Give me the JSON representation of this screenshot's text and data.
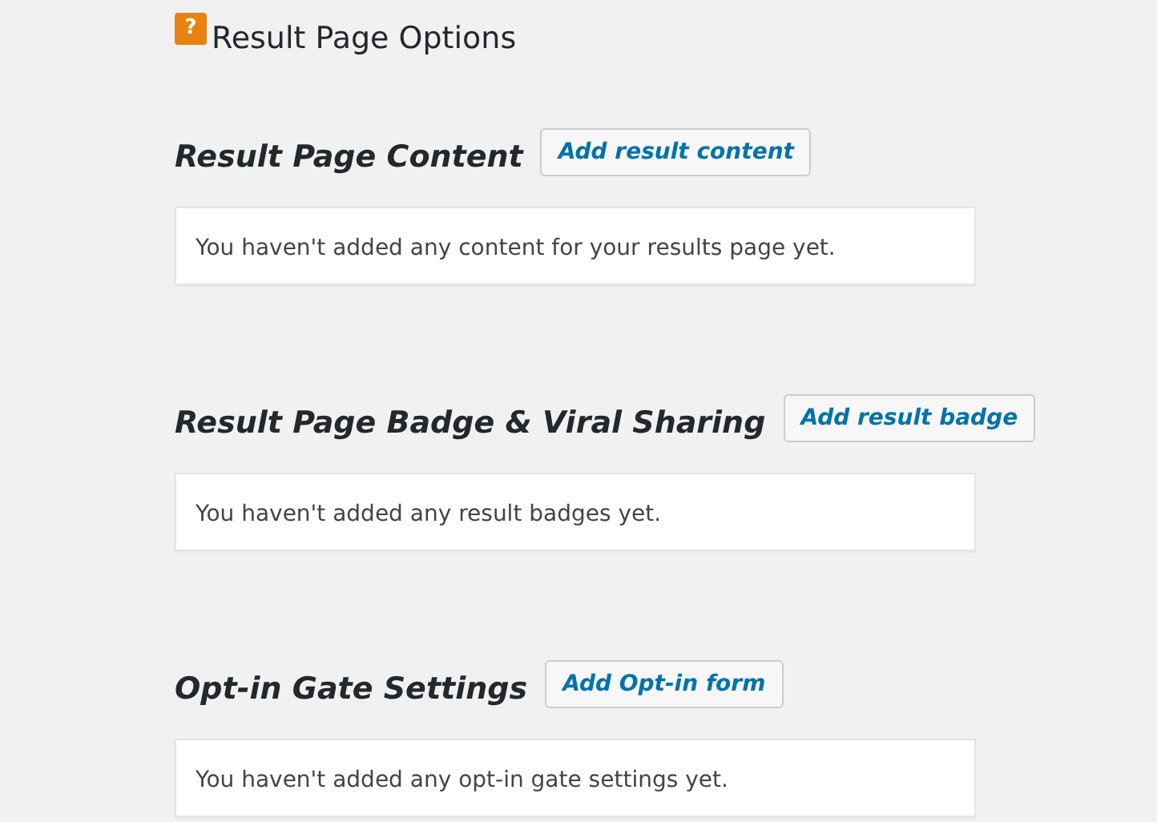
{
  "header": {
    "icon_glyph": "?",
    "title": "Result Page Options"
  },
  "sections": [
    {
      "heading": "Result Page Content",
      "button": "Add result content",
      "message": "You haven't added any content for your results page yet."
    },
    {
      "heading": "Result Page Badge & Viral Sharing",
      "button": "Add result badge",
      "message": "You haven't added any result badges yet."
    },
    {
      "heading": "Opt-in Gate Settings",
      "button": "Add Opt-in form",
      "message": "You haven't added any opt-in gate settings yet."
    }
  ]
}
